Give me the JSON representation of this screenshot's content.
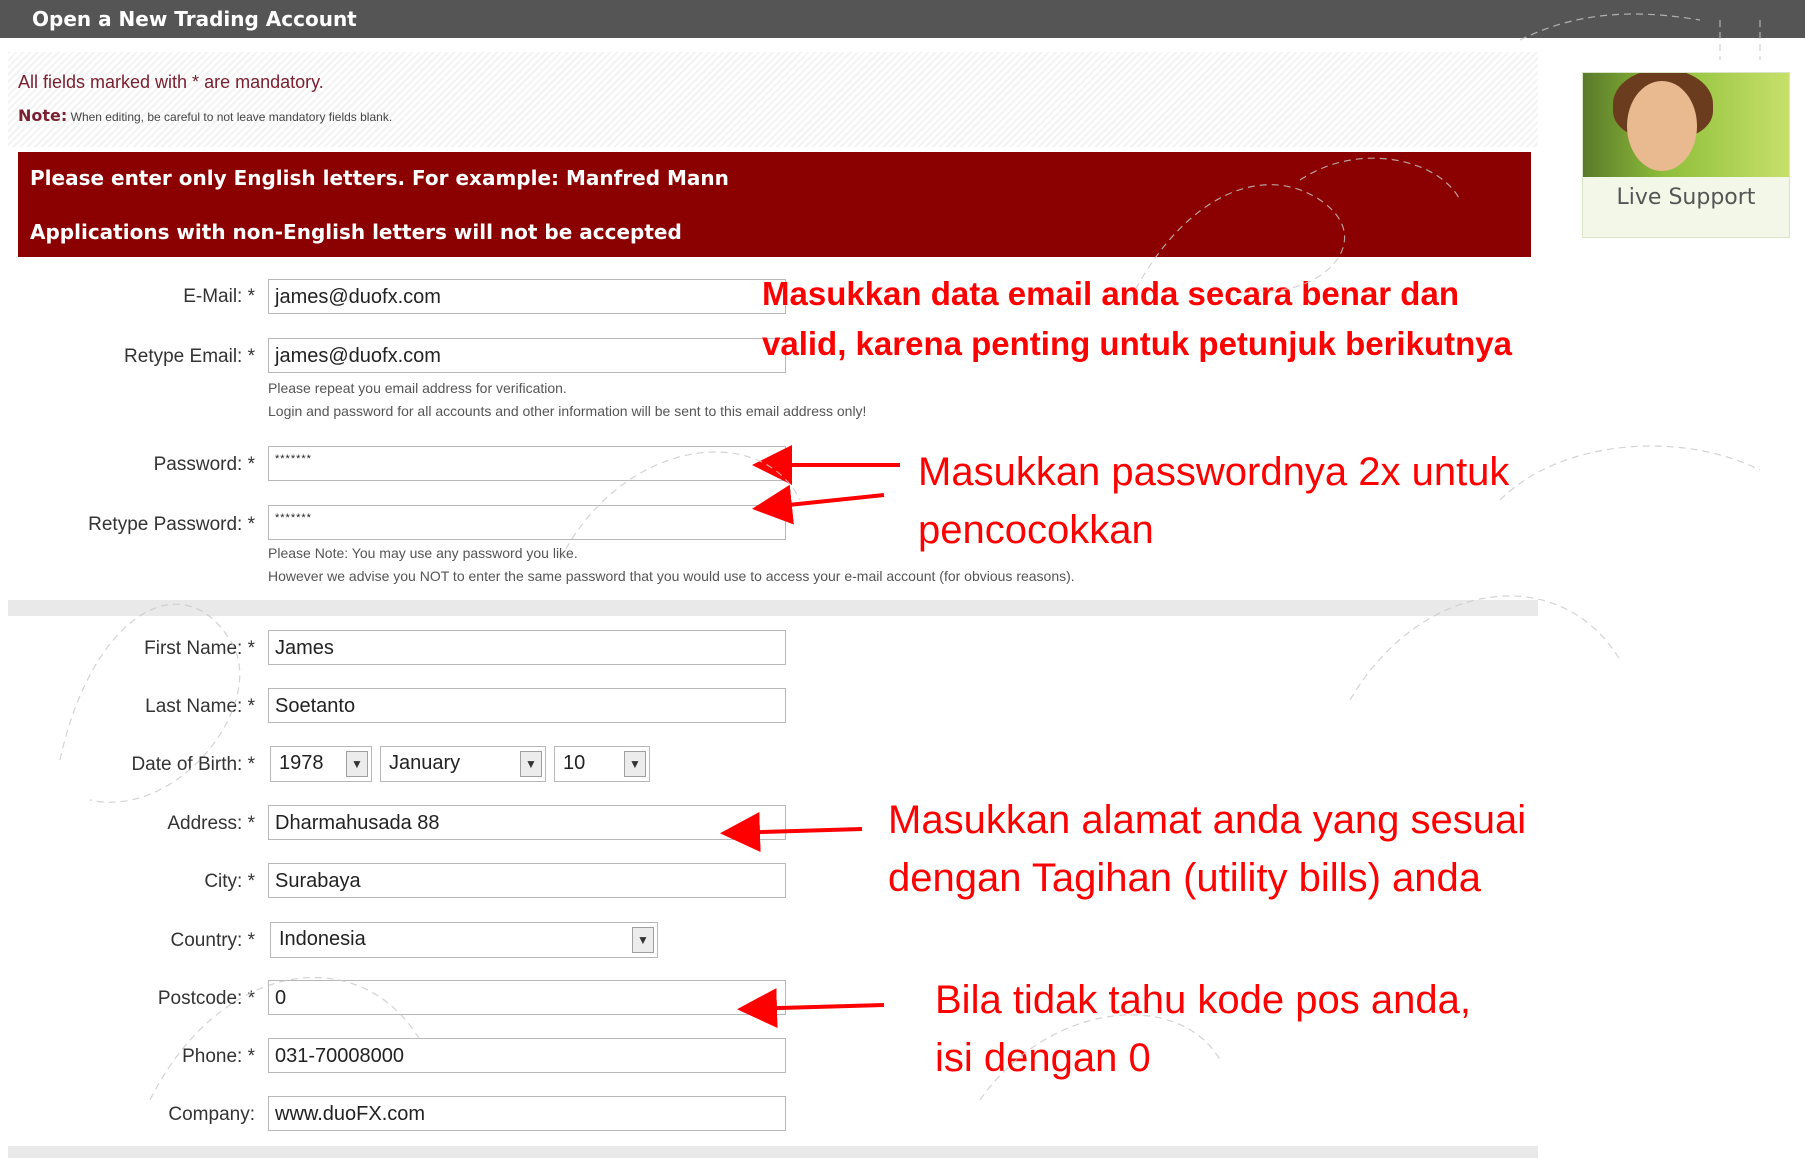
{
  "title": "Open a New Trading Account",
  "notes": {
    "mandatory": "All fields marked with * are mandatory.",
    "note_label": "Note:",
    "note_text": "When editing, be careful to not leave mandatory fields blank."
  },
  "warning": {
    "line1": "Please enter only English letters. For example: Manfred Mann",
    "line2": "Applications with non-English letters will not be accepted"
  },
  "support": {
    "label": "Live Support"
  },
  "form": {
    "email": {
      "label": "E-Mail: *",
      "value": "james@duofx.com"
    },
    "retype_email": {
      "label": "Retype Email: *",
      "value": "james@duofx.com",
      "help1": "Please repeat you email address for verification.",
      "help2": "Login and password for all accounts and other information will be sent to this email address only!"
    },
    "password": {
      "label": "Password: *",
      "value": "*******"
    },
    "retype_password": {
      "label": "Retype Password: *",
      "value": "*******",
      "help1": "Please Note: You may use any password you like.",
      "help2": "However we advise you NOT to enter the same password that you would use to access your e-mail account (for obvious reasons)."
    },
    "first_name": {
      "label": "First Name: *",
      "value": "James"
    },
    "last_name": {
      "label": "Last Name: *",
      "value": "Soetanto"
    },
    "dob": {
      "label": "Date of Birth: *",
      "year": "1978",
      "month": "January",
      "day": "10"
    },
    "address": {
      "label": "Address: *",
      "value": "Dharmahusada 88"
    },
    "city": {
      "label": "City: *",
      "value": "Surabaya"
    },
    "country": {
      "label": "Country: *",
      "value": "Indonesia"
    },
    "postcode": {
      "label": "Postcode: *",
      "value": "0"
    },
    "phone": {
      "label": "Phone: *",
      "value": "031-70008000"
    },
    "company": {
      "label": "Company:",
      "value": "www.duoFX.com"
    }
  },
  "annotations": {
    "email_1": "Masukkan data email anda secara benar dan",
    "email_2": "valid, karena penting untuk petunjuk berikutnya",
    "password_1": "Masukkan passwordnya 2x untuk",
    "password_2": "pencocokkan",
    "address_1": "Masukkan alamat anda yang sesuai",
    "address_2": "dengan Tagihan (utility bills) anda",
    "postcode_1": "Bila tidak tahu kode pos anda,",
    "postcode_2": "isi dengan 0"
  },
  "colors": {
    "annotation": "#ff0000",
    "warning_bg": "#8b0000",
    "titlebar": "#555555"
  }
}
